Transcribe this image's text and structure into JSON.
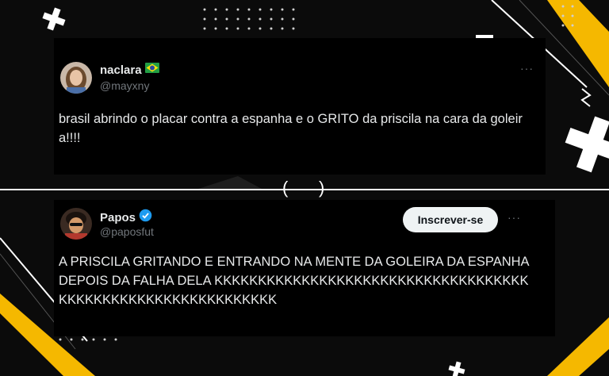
{
  "colors": {
    "background": "#0b0b0b",
    "card": "#000000",
    "accent_yellow": "#f5b800",
    "verified_blue": "#1d9bf0",
    "text": "#e7e9ea",
    "muted": "#71767b"
  },
  "tweets": [
    {
      "display_name": "naclara",
      "flag": "brazil-flag-icon",
      "handle": "@mayxny",
      "text": "brasil abrindo o placar contra a espanha e o GRITO da priscila na cara da goleira!!!!",
      "more": "···"
    },
    {
      "display_name": "Papos",
      "verified": true,
      "handle": "@paposfut",
      "subscribe_label": "Inscrever-se",
      "text": "A PRISCILA GRITANDO E ENTRANDO NA MENTE DA GOLEIRA DA ESPANHA DEPOIS DA FALHA DELA KKKKKKKKKKKKKKKKKKKKKKKKKKKKKKKKKKKKKKKKKKKKKKKKKKKKKKKKKKKKK",
      "more": "···"
    }
  ],
  "divider": {
    "left_paren": "(",
    "right_paren": ")"
  }
}
